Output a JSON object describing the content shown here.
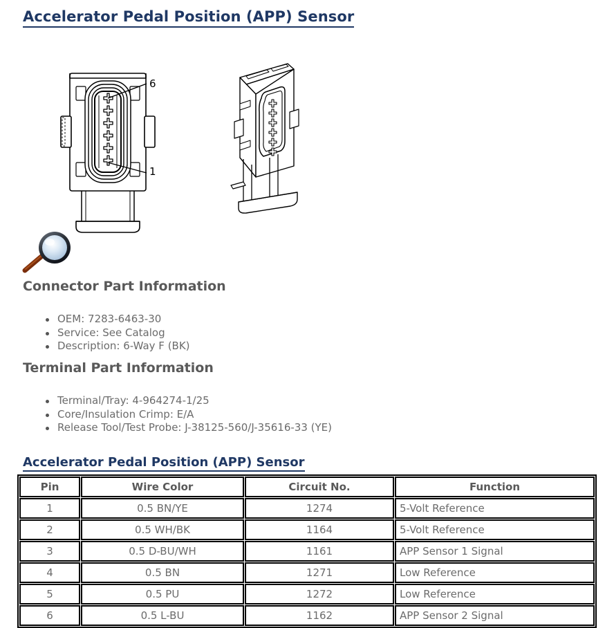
{
  "page": {
    "title": "Accelerator Pedal Position (APP) Sensor",
    "title_color": "#1f3864"
  },
  "illustration": {
    "front_view": {
      "name": "connector-front-view",
      "pin_labels": [
        {
          "label": "6",
          "position": "top"
        },
        {
          "label": "1",
          "position": "bottom"
        }
      ],
      "cavity_count": 6
    },
    "iso_view": {
      "name": "connector-isometric-view"
    },
    "magnifier_icon": {
      "name": "magnifier-icon",
      "lens_color": "#d6e4f0",
      "rim_color": "#2b2b2b",
      "handle_color": "#8b3a10"
    }
  },
  "connector_part_information": {
    "heading": "Connector Part Information",
    "items": [
      "OEM: 7283-6463-30",
      "Service: See Catalog",
      "Description: 6-Way F (BK)"
    ]
  },
  "terminal_part_information": {
    "heading": "Terminal Part Information",
    "items": [
      "Terminal/Tray: 4-964274-1/25",
      "Core/Insulation Crimp: E/A",
      "Release Tool/Test Probe: J-38125-560/J-35616-33 (YE)"
    ]
  },
  "pin_table": {
    "title": "Accelerator Pedal Position (APP) Sensor",
    "headers": [
      "Pin",
      "Wire Color",
      "Circuit No.",
      "Function"
    ],
    "rows": [
      {
        "pin": "1",
        "wire_color": "0.5 BN/YE",
        "circuit_no": "1274",
        "function": "5-Volt Reference"
      },
      {
        "pin": "2",
        "wire_color": "0.5 WH/BK",
        "circuit_no": "1164",
        "function": "5-Volt Reference"
      },
      {
        "pin": "3",
        "wire_color": "0.5 D-BU/WH",
        "circuit_no": "1161",
        "function": "APP Sensor 1 Signal"
      },
      {
        "pin": "4",
        "wire_color": "0.5 BN",
        "circuit_no": "1271",
        "function": "Low Reference"
      },
      {
        "pin": "5",
        "wire_color": "0.5 PU",
        "circuit_no": "1272",
        "function": "Low Reference"
      },
      {
        "pin": "6",
        "wire_color": "0.5 L-BU",
        "circuit_no": "1162",
        "function": "APP Sensor 2 Signal"
      }
    ]
  }
}
